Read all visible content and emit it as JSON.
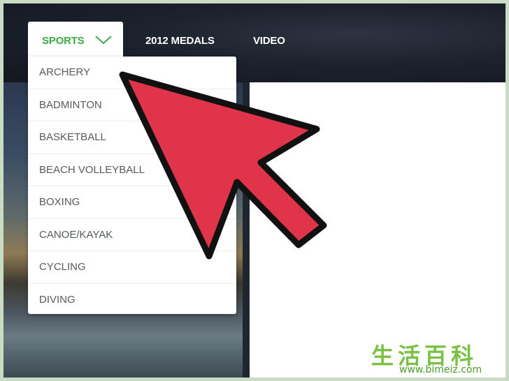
{
  "nav": {
    "sports_label": "SPORTS",
    "medals_label": "2012 MEDALS",
    "video_label": "VIDEO"
  },
  "dropdown": {
    "items": [
      "ARCHERY",
      "BADMINTON",
      "BASKETBALL",
      "BEACH VOLLEYBALL",
      "BOXING",
      "CANOE/KAYAK",
      "CYCLING",
      "DIVING"
    ]
  },
  "colors": {
    "accent_green": "#3fa943",
    "arrow_red": "#e0344a",
    "topbar_dark": "#1c222c"
  },
  "watermark": {
    "chinese": "生活百科",
    "url": "www.bimeiz.com"
  }
}
